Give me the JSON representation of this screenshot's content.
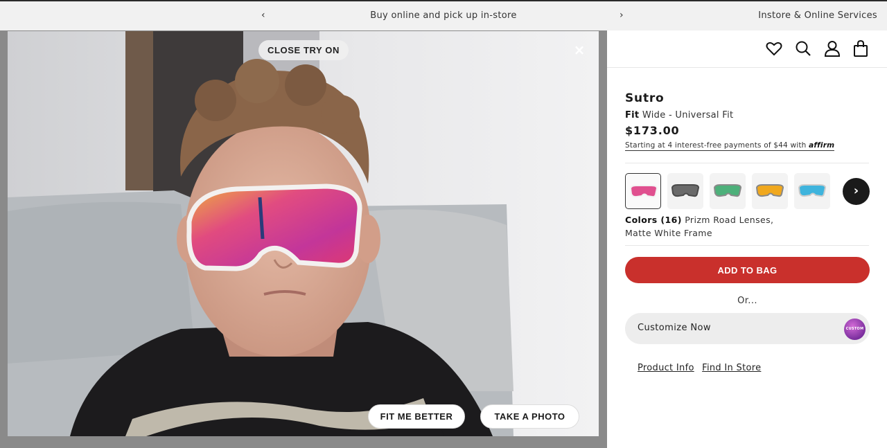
{
  "topbar": {
    "prev_arrow": "‹",
    "promo_text": "Buy online and pick up in-store",
    "next_arrow": "›",
    "services_link": "Instore & Online Services"
  },
  "tryon": {
    "close_label": "CLOSE TRY ON",
    "close_icon": "×",
    "fit_label": "FIT ME BETTER",
    "photo_label": "TAKE A PHOTO"
  },
  "header_icons": [
    "heart-icon",
    "search-icon",
    "account-icon",
    "bag-icon"
  ],
  "product": {
    "name": "Sutro",
    "fit_label": "Fit",
    "fit_value": "Wide - Universal Fit",
    "price": "$173.00",
    "affirm_text": "Starting at 4 interest-free payments of $44 with",
    "affirm_logo": "affirm"
  },
  "swatches": [
    {
      "name": "prizm-road",
      "lens": "#e0508f",
      "frame": "#f2f2f2",
      "selected": true
    },
    {
      "name": "black",
      "lens": "#6a6a6a",
      "frame": "#4a4a4a",
      "selected": false
    },
    {
      "name": "jade",
      "lens": "#4db07a",
      "frame": "#8a8a8a",
      "selected": false
    },
    {
      "name": "24k",
      "lens": "#f0a81e",
      "frame": "#888888",
      "selected": false
    },
    {
      "name": "sapphire",
      "lens": "#3fb4dd",
      "frame": "#cccccc",
      "selected": false
    }
  ],
  "swatch_next": "›",
  "colors": {
    "label": "Colors (16)",
    "value_line1": "Prizm Road Lenses,",
    "value_line2": "Matte White Frame"
  },
  "actions": {
    "add_to_bag": "ADD TO BAG",
    "or_text": "Or...",
    "customize": "Customize Now",
    "custom_badge": "CUSTOM"
  },
  "links": {
    "product_info": "Product Info",
    "find_in_store": "Find In Store"
  },
  "colors_theme": {
    "add_to_bag_bg": "#c9302c",
    "topbar_bg": "#f1f1f1"
  }
}
